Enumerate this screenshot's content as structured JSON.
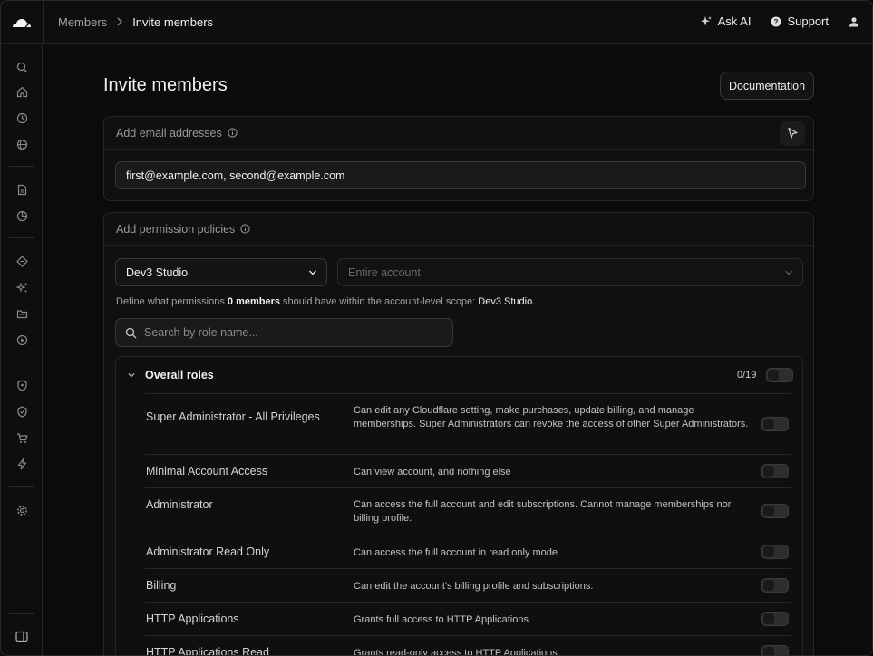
{
  "header": {
    "breadcrumb": {
      "parent": "Members",
      "separator": ">",
      "current": "Invite members"
    },
    "ask_ai_label": "Ask AI",
    "support_label": "Support"
  },
  "sidebar": {
    "icons": [
      "search-icon",
      "home-icon",
      "history-icon",
      "globe-icon",
      "document-icon",
      "analytics-icon",
      "code-icon",
      "ai-sparkle-icon",
      "folder-icon",
      "play-icon",
      "shield-icon",
      "shield-check-icon",
      "cart-icon",
      "lightning-icon",
      "gear-icon",
      "sidebar-toggle-icon"
    ]
  },
  "main": {
    "title": "Invite members",
    "documentation_label": "Documentation",
    "email_section": {
      "label": "Add email addresses",
      "input_value": "first@example.com, second@example.com"
    },
    "permissions_section": {
      "label": "Add permission policies",
      "account_select": "Dev3 Studio",
      "scope_select_placeholder": "Entire account",
      "description": {
        "prefix": "Define what permissions ",
        "count": "0 members",
        "middle": " should have within the account-level scope: ",
        "scope": "Dev3 Studio",
        "suffix": "."
      },
      "search_placeholder": "Search by role name...",
      "roles_group": {
        "title": "Overall roles",
        "count": "0/19",
        "roles": [
          {
            "name": "Super Administrator - All Privileges",
            "description": "Can edit any Cloudflare setting, make purchases, update billing, and manage memberships. Super Administrators can revoke the access of other Super Administrators.",
            "enabled": false
          },
          {
            "name": "Minimal Account Access",
            "description": "Can view account, and nothing else",
            "enabled": false
          },
          {
            "name": "Administrator",
            "description": "Can access the full account and edit subscriptions. Cannot manage memberships nor billing profile.",
            "enabled": false
          },
          {
            "name": "Administrator Read Only",
            "description": "Can access the full account in read only mode",
            "enabled": false
          },
          {
            "name": "Billing",
            "description": "Can edit the account's billing profile and subscriptions.",
            "enabled": false
          },
          {
            "name": "HTTP Applications",
            "description": "Grants full access to HTTP Applications",
            "enabled": false
          },
          {
            "name": "HTTP Applications Read",
            "description": "Grants read-only access to HTTP Applications",
            "enabled": false
          }
        ]
      }
    }
  },
  "colors": {
    "background": "#0b0b0b",
    "panel": "#101010",
    "border": "#262626",
    "text": "#e6e6e6",
    "muted": "#9a9a9a"
  }
}
